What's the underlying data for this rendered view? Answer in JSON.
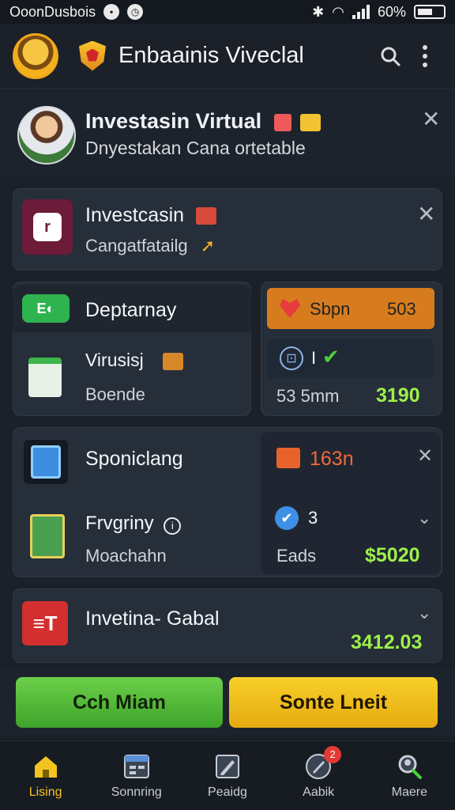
{
  "status_bar": {
    "carrier": "OoonDusbois",
    "battery": "60%"
  },
  "app_bar": {
    "title": "Enbaainis Viveclal"
  },
  "profile": {
    "title": "Investasin Virtual",
    "subtitle": "Dnyestakan Cana ortetable"
  },
  "investasi_card": {
    "title": "Investcasin",
    "subtitle": "Cangatfatailg"
  },
  "deposit_card": {
    "pill_label": "Deptarnay",
    "item_title": "Virusisj",
    "item_sub": "Boende"
  },
  "spin_card": {
    "pill_label": "Sbpn",
    "pill_value": "503",
    "status_num": "I",
    "metric_label": "53 5mm",
    "metric_value": "3190"
  },
  "sponsor_card": {
    "title": "Sponiclang",
    "item_title": "Frvgriny",
    "item_sub": "Moachahn"
  },
  "stats_card": {
    "stat1": "163n",
    "stat2": "3",
    "label": "Eads",
    "value": "$5020"
  },
  "invest_card": {
    "title": "Invetina- Gabal",
    "value": "3412.03"
  },
  "actions": {
    "primary": "Cch Miam",
    "secondary": "Sonte Lneit"
  },
  "bottom_nav": [
    {
      "label": "Lising",
      "icon": "home-icon"
    },
    {
      "label": "Sonnring",
      "icon": "calendar-icon"
    },
    {
      "label": "Peaidg",
      "icon": "edit-icon"
    },
    {
      "label": "Aabik",
      "icon": "rocket-icon",
      "badge": "2"
    },
    {
      "label": "Maere",
      "icon": "search-user-icon"
    }
  ],
  "colors": {
    "accent_green": "#5fc43a",
    "accent_yellow": "#f3c420",
    "accent_orange": "#e88a1e",
    "money_green": "#9ef04a"
  }
}
